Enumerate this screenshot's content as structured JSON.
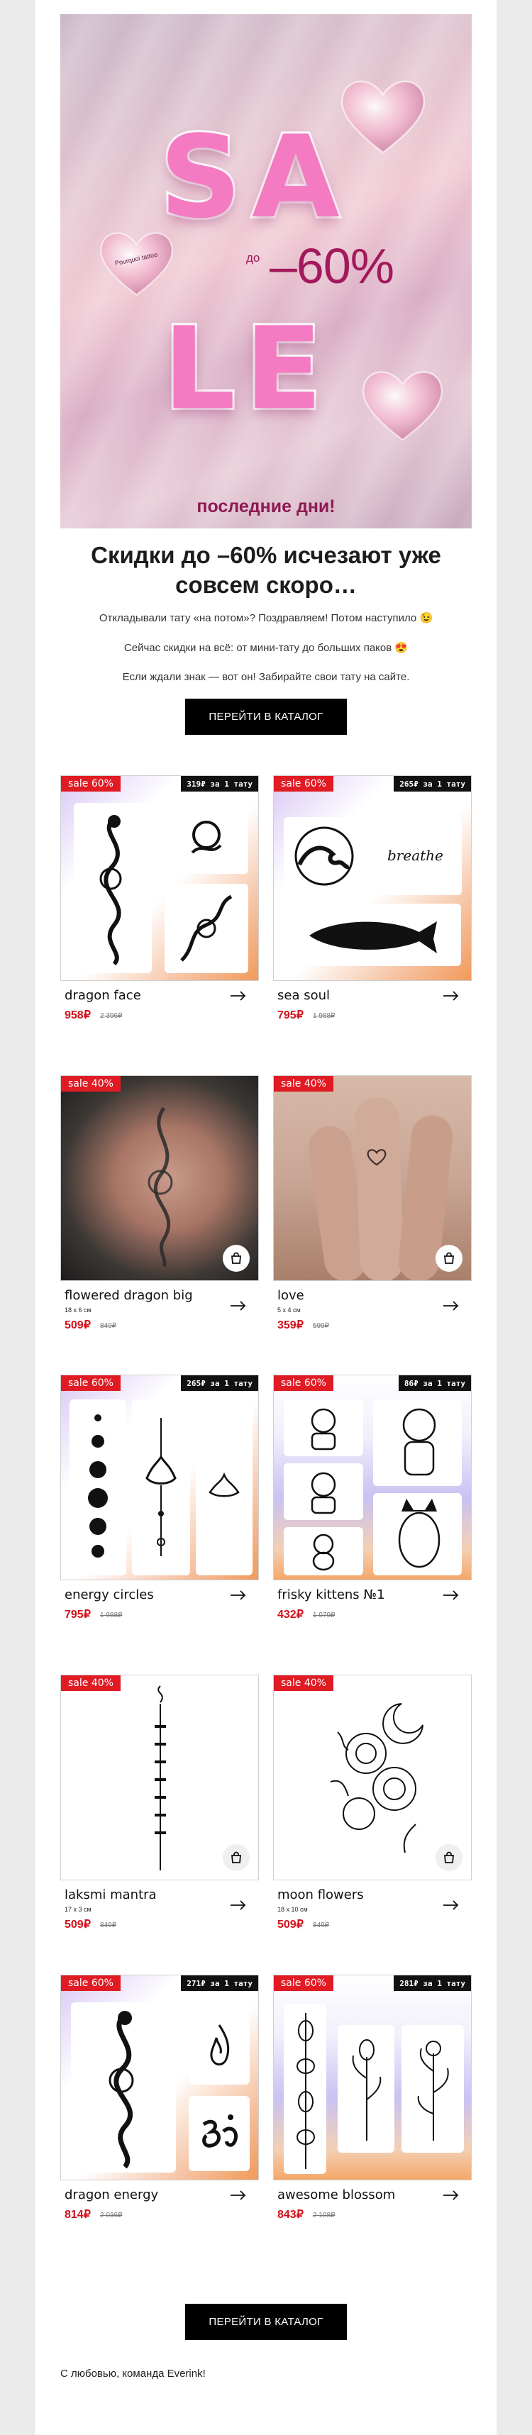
{
  "hero": {
    "letters": {
      "s": "S",
      "a": "A",
      "l": "L",
      "e": "E"
    },
    "discount": "–60%",
    "prefix": "до",
    "badge_text": "Pourquoi tattoo",
    "last_days": "последние дни!"
  },
  "headline": "Скидки до –60% исчезают уже совсем скоро…",
  "paragraphs": [
    "Откладывали тату «на потом»? Поздравляем! Потом наступило 😉",
    "Сейчас скидки на всё: от мини-тату до больших паков 😍",
    "Если ждали знак — вот он! Забирайте свои тату на сайте."
  ],
  "cta_label": "ПЕРЕЙТИ В КАТАЛОГ",
  "products": [
    {
      "badge": "sale 60%",
      "per": "319₽ за 1 тату",
      "name": "dragon face",
      "size": "",
      "price": "958₽",
      "old": "2 396₽"
    },
    {
      "badge": "sale 60%",
      "per": "265₽ за 1 тату",
      "name": "sea soul",
      "size": "",
      "price": "795₽",
      "old": "1 988₽"
    },
    {
      "badge": "sale 40%",
      "per": "",
      "name": "flowered dragon big",
      "size": "18 x 6 см",
      "price": "509₽",
      "old": "849₽"
    },
    {
      "badge": "sale 40%",
      "per": "",
      "name": "love",
      "size": "5 x 4 см",
      "price": "359₽",
      "old": "599₽"
    },
    {
      "badge": "sale 60%",
      "per": "265₽ за 1 тату",
      "name": "energy circles",
      "size": "",
      "price": "795₽",
      "old": "1 988₽"
    },
    {
      "badge": "sale 60%",
      "per": "86₽ за 1 тату",
      "name": "frisky kittens №1",
      "size": "",
      "price": "432₽",
      "old": "1 079₽"
    },
    {
      "badge": "sale 40%",
      "per": "",
      "name": "laksmi mantra",
      "size": "17 x 3 см",
      "price": "509₽",
      "old": "849₽"
    },
    {
      "badge": "sale 40%",
      "per": "",
      "name": "moon flowers",
      "size": "18 x 10 см",
      "price": "509₽",
      "old": "849₽"
    },
    {
      "badge": "sale 60%",
      "per": "271₽ за 1 тату",
      "name": "dragon energy",
      "size": "",
      "price": "814₽",
      "old": "2 036₽"
    },
    {
      "badge": "sale 60%",
      "per": "281₽ за 1 тату",
      "name": "awesome blossom",
      "size": "",
      "price": "843₽",
      "old": "2 108₽"
    }
  ],
  "tattoo_text": "breathe",
  "cta2_label": "ПЕРЕЙТИ В КАТАЛОГ",
  "signature": "С любовью, команда Everink!",
  "colors": {
    "sale_red": "#e01b24",
    "price_red": "#d3111b",
    "button": "#000000"
  }
}
